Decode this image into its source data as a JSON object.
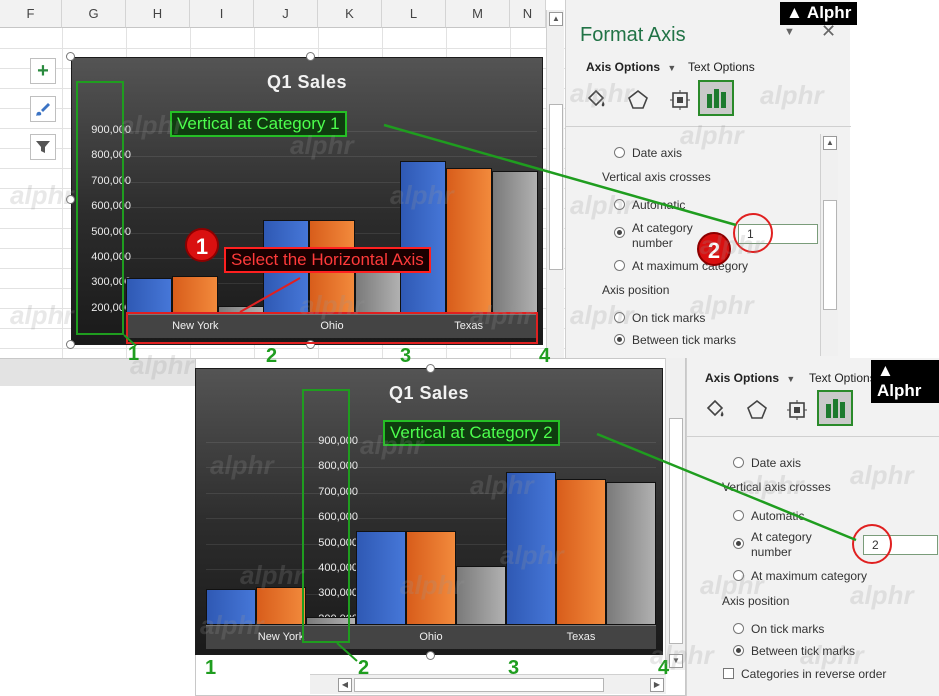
{
  "brand": {
    "logo_text": "Alphr",
    "watermark_text": "alphr"
  },
  "sheet": {
    "columns": [
      "F",
      "G",
      "H",
      "I",
      "J",
      "K",
      "L",
      "M",
      "N"
    ]
  },
  "chart": {
    "title": "Q1 Sales"
  },
  "chart_data": [
    {
      "type": "bar",
      "title": "Q1 Sales",
      "categories": [
        "New York",
        "Ohio",
        "Texas"
      ],
      "series": [
        {
          "values": [
            320000,
            550000,
            780000
          ]
        },
        {
          "values": [
            330000,
            550000,
            755000
          ]
        },
        {
          "values": [
            210000,
            410000,
            740000
          ]
        }
      ],
      "yticks": [
        "200,000",
        "300,000",
        "400,000",
        "500,000",
        "600,000",
        "700,000",
        "800,000",
        "900,000"
      ],
      "ylim": [
        180000,
        950000
      ],
      "vertical_axis_crosses_at_category": 1
    },
    {
      "type": "bar",
      "title": "Q1 Sales",
      "categories": [
        "New York",
        "Ohio",
        "Texas"
      ],
      "series": [
        {
          "values": [
            320000,
            550000,
            780000
          ]
        },
        {
          "values": [
            330000,
            550000,
            755000
          ]
        },
        {
          "values": [
            210000,
            410000,
            740000
          ]
        }
      ],
      "yticks": [
        "200,000",
        "300,000",
        "400,000",
        "500,000",
        "600,000",
        "700,000",
        "800,000",
        "900,000"
      ],
      "ylim": [
        180000,
        950000
      ],
      "vertical_axis_crosses_at_category": 2
    }
  ],
  "colors": {
    "series": [
      "#3d6bcc",
      "#ed7d31",
      "#a5a5a5"
    ],
    "annotation_green": "#1f9d1f",
    "annotation_red": "#e02020"
  },
  "panel": {
    "title": "Format Axis",
    "tab_axis_options": "Axis Options",
    "tab_text_options": "Text Options",
    "icons": [
      "fill-bucket-icon",
      "pentagon-icon",
      "size-properties-icon",
      "bar-chart-icon"
    ],
    "date_axis": "Date axis",
    "vertical_axis_crosses": "Vertical axis crosses",
    "automatic": "Automatic",
    "at_category_line1": "At category",
    "at_category_line2": "number",
    "at_maximum_category": "At maximum category",
    "axis_position": "Axis position",
    "on_tick_marks": "On tick marks",
    "between_tick_marks": "Between tick marks",
    "categories_reverse": "Categories in reverse order",
    "category_value_top": "1",
    "category_value_bottom": "2"
  },
  "annotations": {
    "vertical_cat_1": "Vertical at Category 1",
    "vertical_cat_2": "Vertical at Category 2",
    "select_horizontal": "Select the Horizontal Axis",
    "step_1": "1",
    "step_2": "2",
    "cat_nums": [
      "1",
      "2",
      "3",
      "4"
    ]
  }
}
